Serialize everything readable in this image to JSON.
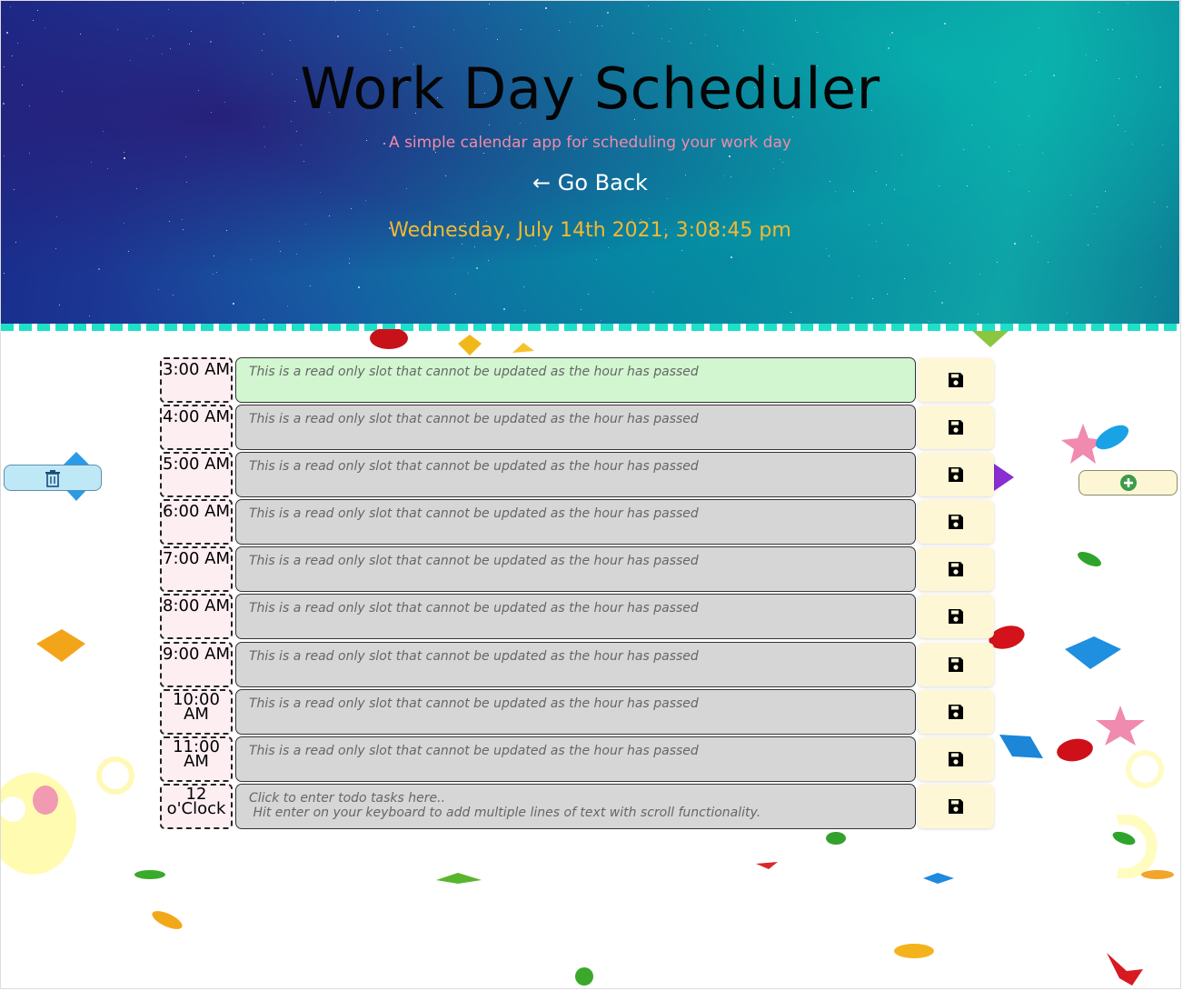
{
  "header": {
    "title": "Work Day Scheduler",
    "subtitle": "A simple calendar app for scheduling your work day",
    "go_back": "← Go Back",
    "current_datetime": "Wednesday, July 14th 2021, 3:08:45 pm"
  },
  "colors": {
    "current_slot": "#d1f6d0",
    "past_slot": "#d6d6d6",
    "hour_label_bg": "#fdeef2",
    "save_button_bg": "#fdf7d6",
    "date_text": "#f5b82e",
    "subtitle_text": "#f28aa8",
    "border_accent": "#1ee0c8"
  },
  "side_buttons": {
    "delete_icon": "trash-icon",
    "add_icon": "plus-circle-icon"
  },
  "schedule": [
    {
      "hour_line1": "3:00 AM",
      "hour_line2": "",
      "text_line1": "This is a read only slot that cannot be updated as the hour has passed",
      "text_line2": "",
      "status": "current"
    },
    {
      "hour_line1": "4:00 AM",
      "hour_line2": "",
      "text_line1": "This is a read only slot that cannot be updated as the hour has passed",
      "text_line2": "",
      "status": "past"
    },
    {
      "hour_line1": "5:00 AM",
      "hour_line2": "",
      "text_line1": "This is a read only slot that cannot be updated as the hour has passed",
      "text_line2": "",
      "status": "past"
    },
    {
      "hour_line1": "6:00 AM",
      "hour_line2": "",
      "text_line1": "This is a read only slot that cannot be updated as the hour has passed",
      "text_line2": "",
      "status": "past"
    },
    {
      "hour_line1": "7:00 AM",
      "hour_line2": "",
      "text_line1": "This is a read only slot that cannot be updated as the hour has passed",
      "text_line2": "",
      "status": "past"
    },
    {
      "hour_line1": "8:00 AM",
      "hour_line2": "",
      "text_line1": "This is a read only slot that cannot be updated as the hour has passed",
      "text_line2": "",
      "status": "past"
    },
    {
      "hour_line1": "9:00 AM",
      "hour_line2": "",
      "text_line1": "This is a read only slot that cannot be updated as the hour has passed",
      "text_line2": "",
      "status": "past"
    },
    {
      "hour_line1": "10:00",
      "hour_line2": "AM",
      "text_line1": "This is a read only slot that cannot be updated as the hour has passed",
      "text_line2": "",
      "status": "past"
    },
    {
      "hour_line1": "11:00",
      "hour_line2": "AM",
      "text_line1": "This is a read only slot that cannot be updated as the hour has passed",
      "text_line2": "",
      "status": "past"
    },
    {
      "hour_line1": "12",
      "hour_line2": "o'Clock",
      "text_line1": "Click to enter todo tasks here..",
      "text_line2": " Hit enter on your keyboard to add multiple lines of text with scroll functionality.",
      "status": "editable"
    }
  ],
  "save_icon": "floppy-disk-icon"
}
